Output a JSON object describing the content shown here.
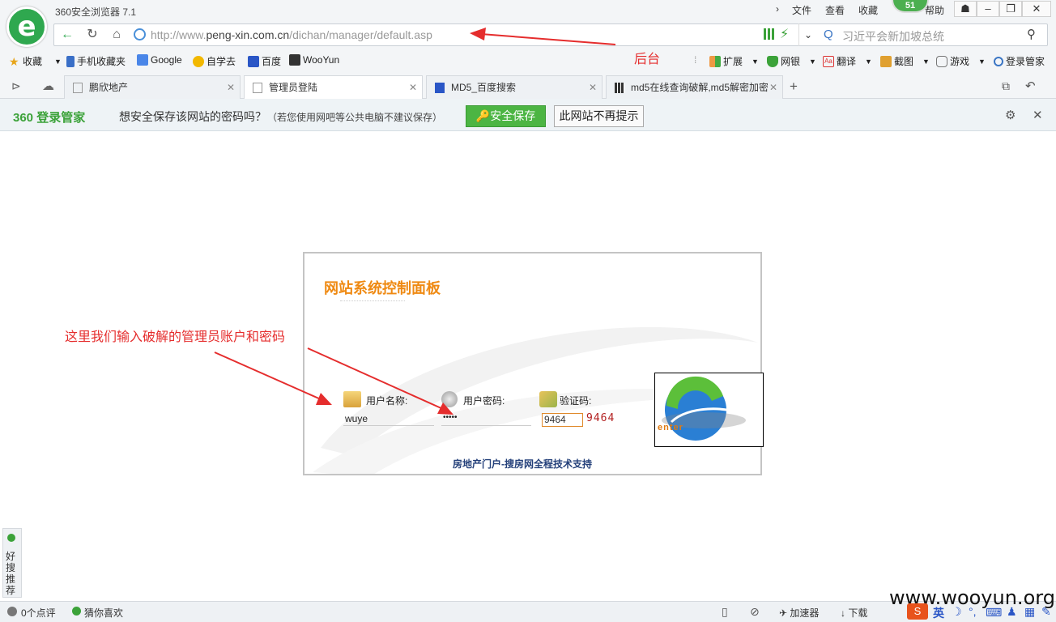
{
  "app": {
    "title": "360安全浏览器 7.1",
    "logo_letter": "e",
    "badge": "51"
  },
  "title_menu": [
    "文件",
    "查看",
    "收藏",
    "帮助"
  ],
  "navbar": {
    "url_prefix": "http://www.",
    "url_domain": "peng-xin.com.cn",
    "url_path": "/dichan/manager/default.asp",
    "search_placeholder": "习近平会新加坡总统"
  },
  "bookmarks": [
    {
      "label": "收藏",
      "color": "#e7a51a"
    },
    {
      "label": "手机收藏夹",
      "color": "#3a6fc7"
    },
    {
      "label": "Google",
      "color": "#4a86e8"
    },
    {
      "label": "自学去",
      "color": "#f2b800"
    },
    {
      "label": "百度",
      "color": "#2a56c6"
    },
    {
      "label": "WooYun",
      "color": "#333333"
    }
  ],
  "tools": [
    {
      "label": "扩展"
    },
    {
      "label": "网银"
    },
    {
      "label": "翻译"
    },
    {
      "label": "截图"
    },
    {
      "label": "游戏"
    },
    {
      "label": "登录管家"
    }
  ],
  "tabs": [
    {
      "label": "鹏欣地产"
    },
    {
      "label": "管理员登陆",
      "active": true
    },
    {
      "label": "MD5_百度搜索"
    },
    {
      "label": "md5在线查询破解,md5解密加密"
    }
  ],
  "password_bar": {
    "brand": "360 登录管家",
    "question": "想安全保存该网站的密码吗？",
    "note": "（若您使用网吧等公共电脑不建议保存）",
    "save": "安全保存",
    "never": "此网站不再提示"
  },
  "login": {
    "title": "网站系统控制面板",
    "username_label": "用户名称:",
    "username_value": "wuye",
    "password_label": "用户密码:",
    "password_value": "•••••",
    "captcha_label": "验证码:",
    "captcha_value": "9464",
    "captcha_image_text": "9464",
    "enter_text": "enter",
    "footer": "房地产门户-搜房网全程技术支持"
  },
  "annotations": {
    "backend": "后台",
    "credentials": "这里我们输入破解的管理员账户和密码"
  },
  "side": {
    "label": "好搜推荐"
  },
  "status": {
    "comments": "0个点评",
    "guess": "猜你喜欢",
    "accelerator": "加速器",
    "download": "下载",
    "ime": "英"
  },
  "watermark": "www.wooyun.org"
}
